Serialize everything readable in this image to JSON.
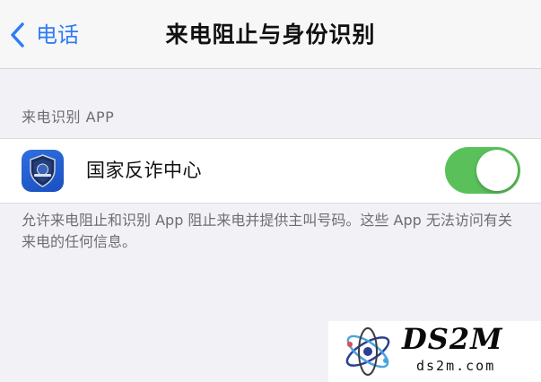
{
  "nav": {
    "back_label": "电话",
    "title": "来电阻止与身份识别"
  },
  "section": {
    "header": "来电识别 APP",
    "apps": [
      {
        "name": "国家反诈中心",
        "icon": "anti-fraud-shield-icon",
        "enabled": true
      }
    ],
    "footer": "允许来电阻止和识别 App 阻止来电并提供主叫号码。这些 App 无法访问有关来电的任何信息。"
  },
  "watermark": {
    "title": "DS2M",
    "subtitle": "ds2m.com"
  },
  "colors": {
    "accent": "#2f7cf6",
    "toggle_on": "#5ac15a",
    "background": "#f2f2f6"
  }
}
